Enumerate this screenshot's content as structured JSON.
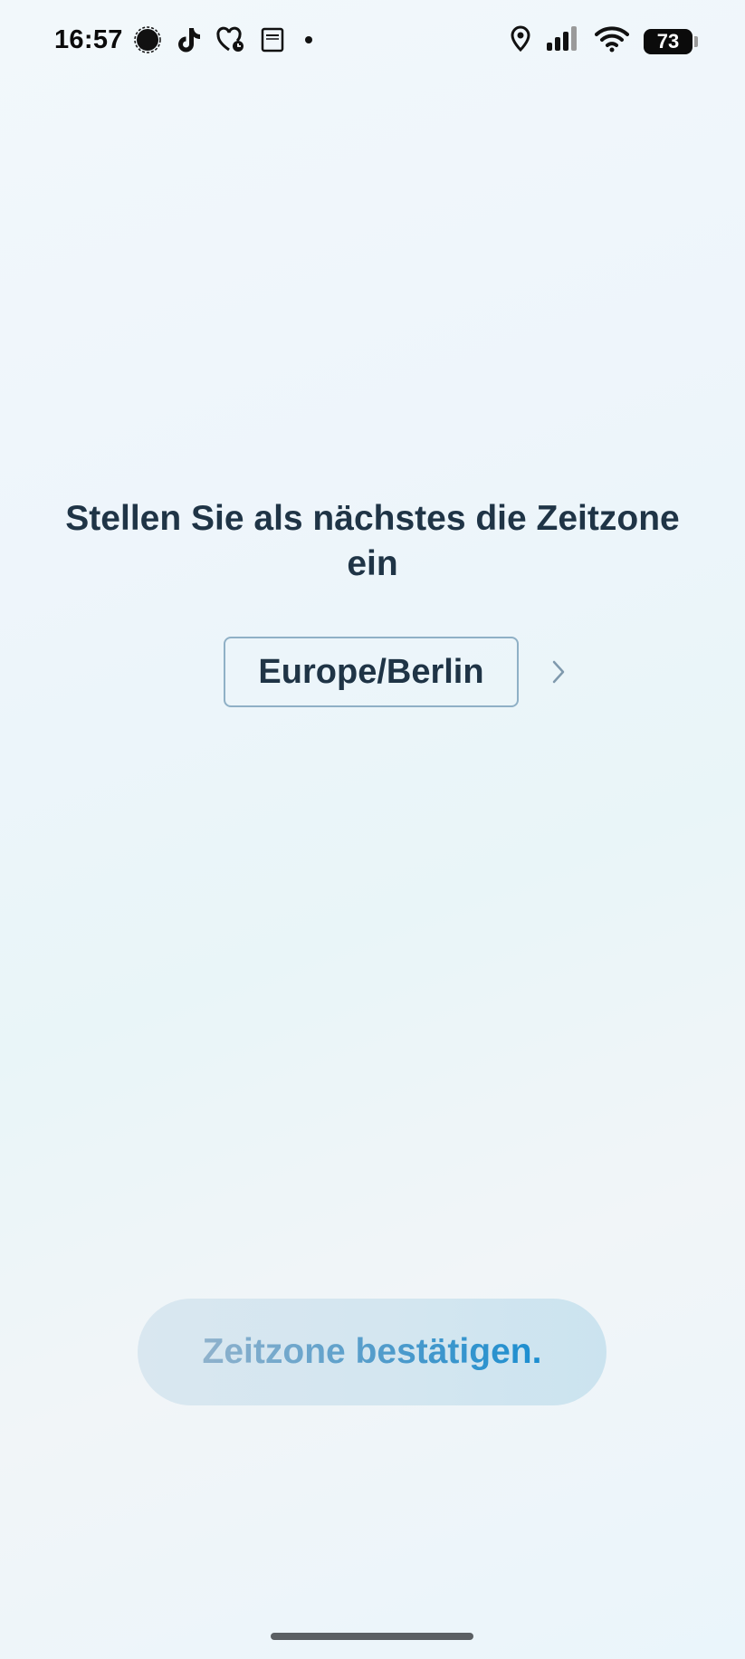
{
  "status_bar": {
    "time": "16:57",
    "left_icons": [
      "signal-app-icon",
      "tiktok-icon",
      "health-icon",
      "calendar-widget-icon",
      "notification-dot-icon"
    ],
    "right_icons": [
      "location-icon",
      "cellular-signal-icon",
      "wifi-icon",
      "battery-icon"
    ],
    "battery_level": "73"
  },
  "main": {
    "heading": "Stellen Sie als nächstes die Zeitzone ein",
    "timezone_value": "Europe/Berlin",
    "chevron_icon": "chevron-right-icon"
  },
  "confirm_button": {
    "label": "Zeitzone bestätigen."
  },
  "colors": {
    "text_primary": "#1f3446",
    "accent": "#1b8ed0",
    "field_border": "#8fb0c6"
  }
}
